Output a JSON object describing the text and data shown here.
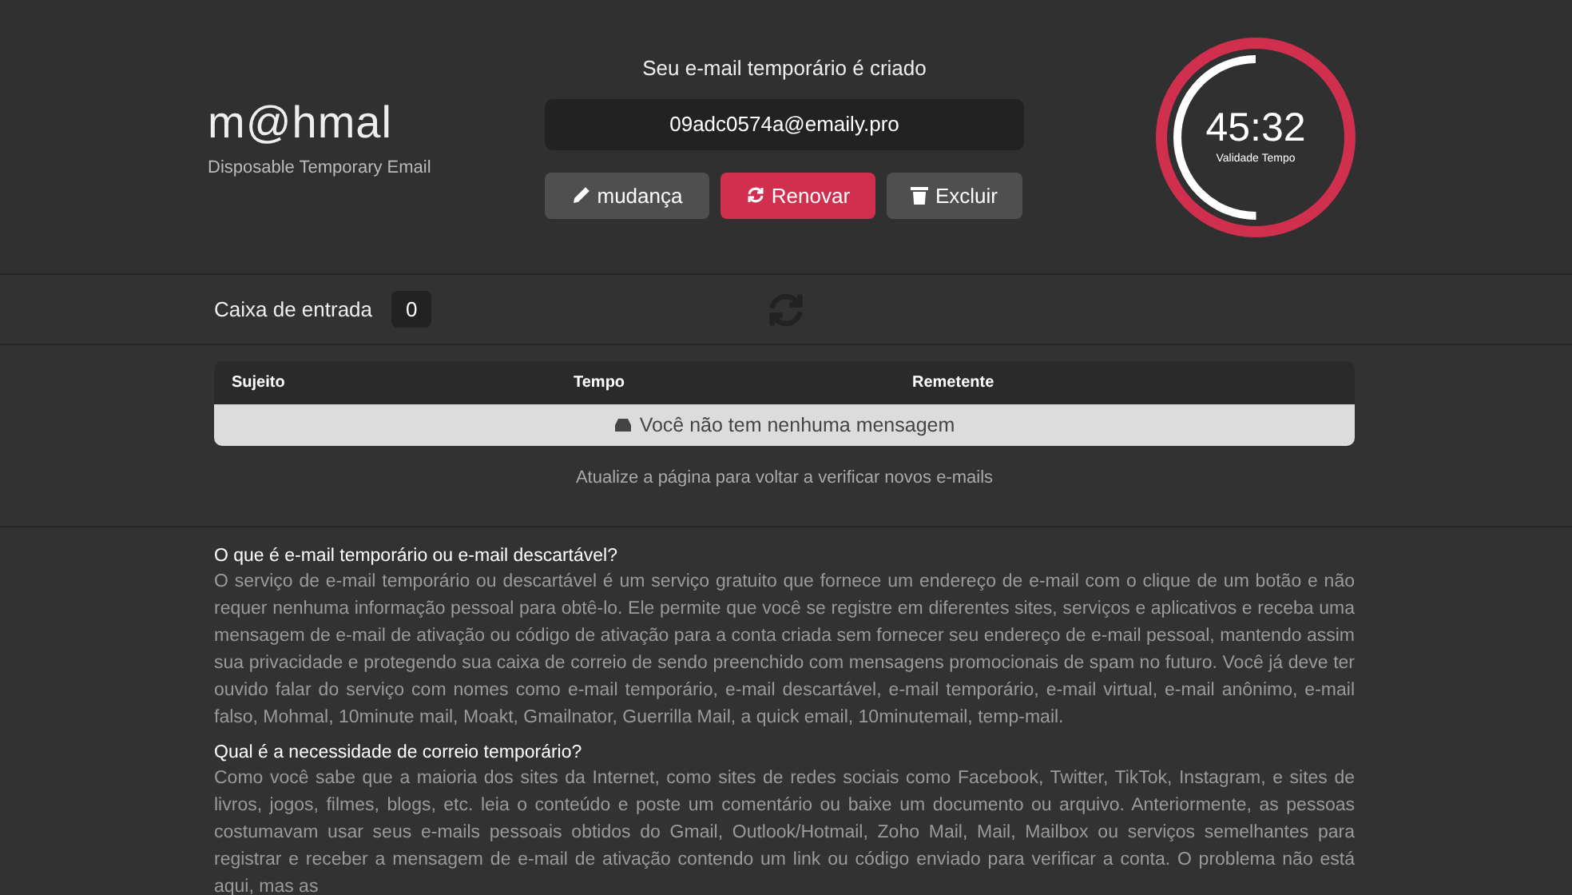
{
  "logo": {
    "name": "m@hmal",
    "tagline": "Disposable Temporary Email"
  },
  "email": {
    "heading": "Seu e-mail temporário é criado",
    "address": "09adc0574a@emaily.pro"
  },
  "actions": [
    {
      "kind": "edit",
      "label": "mudança",
      "primary": false
    },
    {
      "kind": "refresh",
      "label": "Renovar",
      "primary": true
    },
    {
      "kind": "delete",
      "label": "Excluir",
      "primary": false
    }
  ],
  "timer": {
    "time": "45:32",
    "caption": "Validade Tempo",
    "level": 0.5
  },
  "inbox": {
    "label": "Caixa de entrada",
    "count": "0"
  },
  "table": {
    "columns": [
      "Sujeito",
      "Tempo",
      "Remetente"
    ],
    "empty": "Você não tem nenhuma mensagem",
    "hint": "Atualize a página para voltar a verificar novos e-mails"
  },
  "articles": [
    {
      "title": "O que é e-mail temporário ou e-mail descartável?",
      "body": "O serviço de e-mail temporário ou descartável é um serviço gratuito que fornece um endereço de e-mail com o clique de um botão e não requer nenhuma informação pessoal para obtê-lo. Ele permite que você se registre em diferentes sites, serviços e aplicativos e receba uma mensagem de e-mail de ativação ou código de ativação para a conta criada sem fornecer seu endereço de e-mail pessoal, mantendo assim sua privacidade e protegendo sua caixa de correio de sendo preenchido com mensagens promocionais de spam no futuro. Você já deve ter ouvido falar do serviço com nomes como e-mail temporário, e-mail descartável, e-mail temporário, e-mail virtual, e-mail anônimo, e-mail falso, Mohmal, 10minute mail, Moakt, Gmailnator, Guerrilla Mail, a quick email, 10minutemail, temp-mail."
    },
    {
      "title": "Qual é a necessidade de correio temporário?",
      "body": "Como você sabe que a maioria dos sites da Internet, como sites de redes sociais como Facebook, Twitter, TikTok, Instagram, e sites de livros, jogos, filmes, blogs, etc. leia o conteúdo e poste um comentário ou baixe um documento ou arquivo. Anteriormente, as pessoas costumavam usar seus e-mails pessoais obtidos do Gmail, Outlook/Hotmail, Zoho Mail, Mail, Mailbox ou serviços semelhantes para registrar e receber a mensagem de e-mail de ativação contendo um link ou código enviado para verificar a conta. O problema não está aqui, mas as"
    }
  ]
}
